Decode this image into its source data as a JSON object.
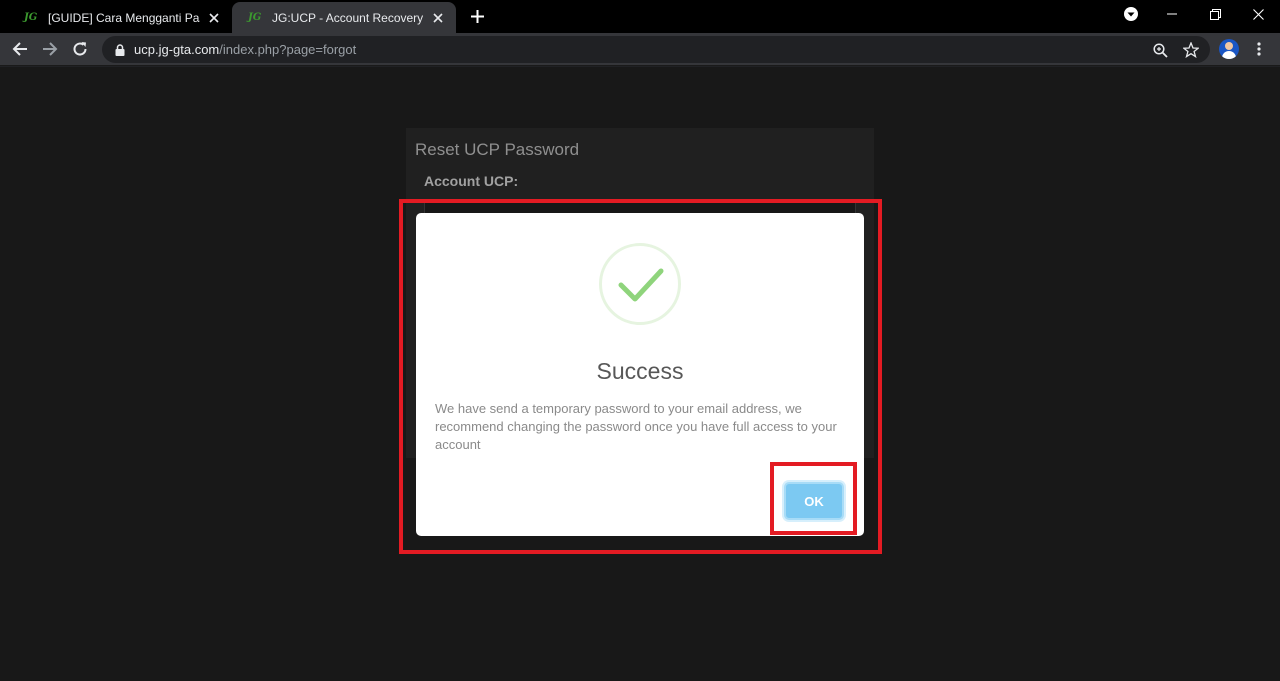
{
  "browser": {
    "tabs": [
      {
        "favicon": "JG",
        "title": "[GUIDE] Cara Mengganti Passwo",
        "active": false
      },
      {
        "favicon": "JG",
        "title": "JG:UCP - Account Recovery",
        "active": true
      }
    ],
    "address": {
      "host": "ucp.jg-gta.com",
      "path": "/index.php?page=forgot"
    },
    "icons": {
      "back": "arrow-left-icon",
      "forward": "arrow-right-icon",
      "reload": "reload-icon",
      "lock": "lock-icon",
      "zoom": "zoom-icon",
      "bookmark": "star-icon",
      "menu": "kebab-menu-icon"
    }
  },
  "page": {
    "panel_title": "Reset UCP Password",
    "account_label": "Account UCP:"
  },
  "modal": {
    "title": "Success",
    "message": "We have send a temporary password to your email address, we recommend changing the password once you have full access to your account",
    "ok_label": "OK"
  },
  "colors": {
    "highlight": "#e31b23",
    "ok_button": "#7cc9f2",
    "check": "#8fd47c",
    "favicon": "#3c9a2f"
  }
}
